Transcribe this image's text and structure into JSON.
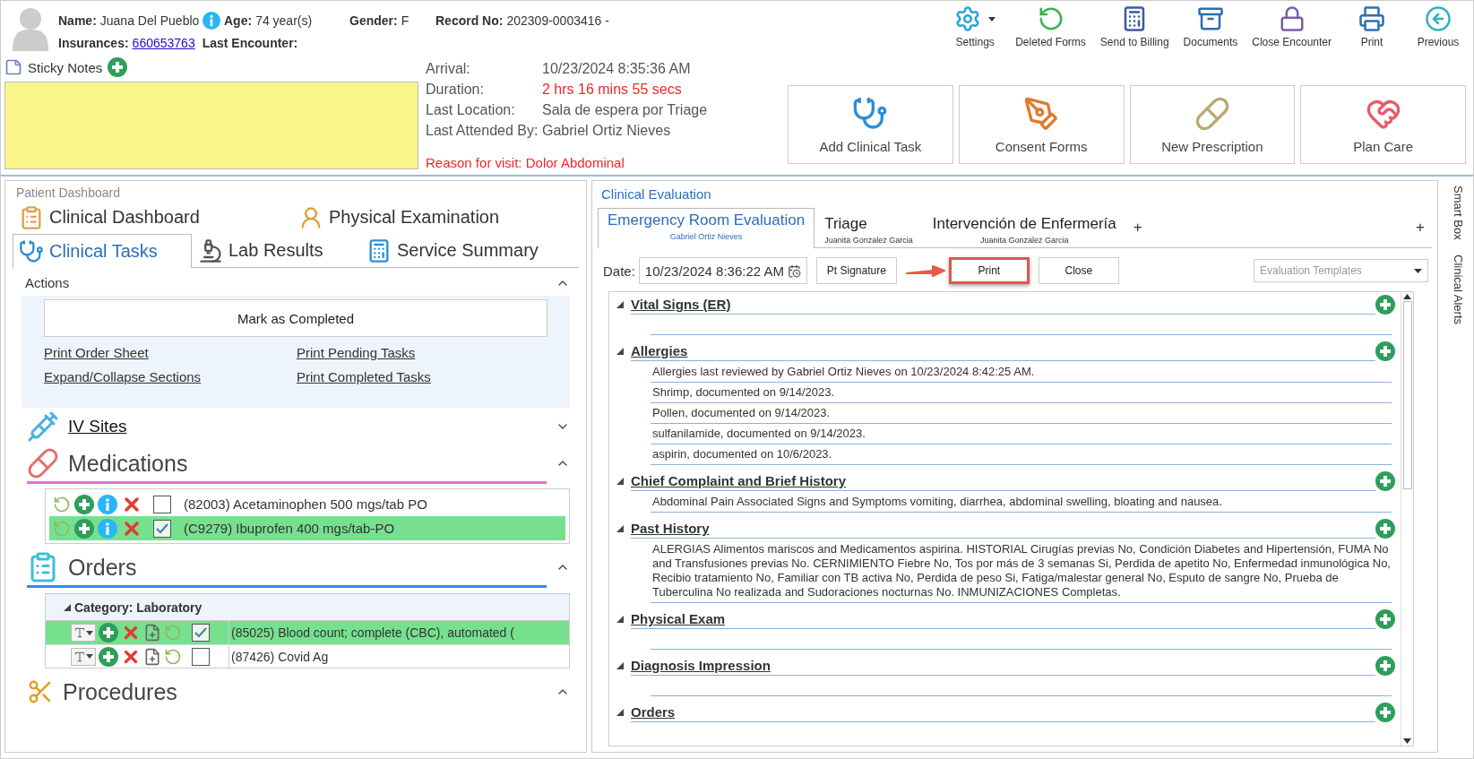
{
  "patient": {
    "name": {
      "label": "Name:",
      "value": "Juana Del Pueblo"
    },
    "age": {
      "label": "Age:",
      "value": "74 year(s)"
    },
    "gender": {
      "label": "Gender:",
      "value": "F"
    },
    "record": {
      "label": "Record No:",
      "value": "202309-0003416 -"
    },
    "insurance": {
      "label": "Insurances:",
      "value": "660653763"
    },
    "last_encounter": {
      "label": "Last Encounter:"
    }
  },
  "toolbar": [
    {
      "label": "Settings",
      "kind": "settings",
      "has_menu": true
    },
    {
      "label": "Deleted Forms",
      "kind": "deleted",
      "has_menu": false
    },
    {
      "label": "Send to Billing",
      "kind": "billing",
      "has_menu": false
    },
    {
      "label": "Documents",
      "kind": "documents",
      "has_menu": false
    },
    {
      "label": "Close Encounter",
      "kind": "lock",
      "has_menu": false
    },
    {
      "label": "Print",
      "kind": "print",
      "has_menu": false
    },
    {
      "label": "Previous",
      "kind": "previous",
      "has_menu": false
    }
  ],
  "sticky_notes": {
    "title": "Sticky Notes"
  },
  "visit": {
    "rows": [
      {
        "label": "Arrival:",
        "value": "10/23/2024 8:35:36 AM",
        "alert": false
      },
      {
        "label": "Duration:",
        "value": "2 hrs 16 mins 55 secs",
        "alert": true
      },
      {
        "label": "Last Location:",
        "value": "Sala de espera por Triage",
        "alert": false
      },
      {
        "label": "Last Attended By:",
        "value": "Gabriel Ortiz Nieves",
        "alert": false
      }
    ],
    "reason": "Reason for visit: Dolor Abdominal"
  },
  "quick_actions": [
    {
      "label": "Add Clinical Task",
      "kind": "task"
    },
    {
      "label": "Consent Forms",
      "kind": "consent"
    },
    {
      "label": "New Prescription",
      "kind": "prescription"
    },
    {
      "label": "Plan Care",
      "kind": "plan"
    }
  ],
  "dashboard": {
    "title": "Patient Dashboard",
    "tab_rows": [
      [
        {
          "label": "Clinical Dashboard",
          "kind": "dashboard",
          "selected": false
        },
        {
          "label": "Physical Examination",
          "kind": "exam",
          "selected": false
        }
      ],
      [
        {
          "label": "Clinical Tasks",
          "kind": "tasks",
          "selected": true
        },
        {
          "label": "Lab Results",
          "kind": "lab",
          "selected": false
        },
        {
          "label": "Service Summary",
          "kind": "summary",
          "selected": false
        }
      ]
    ],
    "actions": {
      "title": "Actions",
      "expanded": true,
      "button": "Mark as Completed",
      "links": [
        "Print Order Sheet",
        "Print Pending Tasks",
        "Expand/Collapse Sections",
        "Print Completed Tasks"
      ]
    },
    "sections": [
      {
        "title": "IV Sites",
        "kind": "iv",
        "expanded": false
      },
      {
        "title": "Medications",
        "kind": "meds",
        "expanded": true,
        "color": "#e070dc",
        "items": [
          {
            "text": "(82003) Acetaminophen 500 mgs/tab PO",
            "checked": false
          },
          {
            "text": "(C9279) Ibuprofen 400 mgs/tab-PO",
            "checked": true
          }
        ]
      },
      {
        "title": "Orders",
        "kind": "orders",
        "expanded": true,
        "color": "#2f8cf0",
        "category": {
          "label": "Category: Laboratory",
          "expanded": true
        },
        "items": [
          {
            "text": "(85025) Blood count; complete (CBC), automated (",
            "checked": true
          },
          {
            "text": "(87426) Covid Ag",
            "checked": false
          }
        ]
      },
      {
        "title": "Procedures",
        "kind": "procedures",
        "expanded": true
      }
    ]
  },
  "evaluation": {
    "title": "Clinical Evaluation",
    "tabs": [
      {
        "title": "Emergency Room Evaluation",
        "subtitle": "Gabriel Ortiz Nieves",
        "selected": true
      },
      {
        "title": "Triage",
        "subtitle": "Juanita Gonzalez Garcia",
        "selected": false
      },
      {
        "title": "Intervención de Enfermería",
        "subtitle": "Juanita Gonzalez Garcia",
        "selected": false
      }
    ],
    "tab_add": "+",
    "pane_add": "+",
    "date": {
      "label": "Date:",
      "value": "10/23/2024 8:36:22 AM"
    },
    "buttons": [
      {
        "label": "Pt Signature",
        "annotated": false
      },
      {
        "label": "Print",
        "annotated": true
      },
      {
        "label": "Close",
        "annotated": false
      }
    ],
    "templates": {
      "placeholder": "Evaluation Templates"
    },
    "sections": [
      {
        "title": "Vital Signs (ER)",
        "expanded": true
      },
      {
        "title": "Allergies",
        "expanded": true,
        "items": [
          "Allergies last reviewed by Gabriel Ortiz Nieves on 10/23/2024 8:42:25 AM.",
          "Shrimp, documented on 9/14/2023.",
          "Pollen, documented on 9/14/2023.",
          "sulfanilamide, documented on 9/14/2023.",
          "aspirin, documented on 10/6/2023."
        ]
      },
      {
        "title": "Chief Complaint and Brief History",
        "expanded": true,
        "items": [
          "Abdominal Pain Associated Signs and Symptoms vomiting, diarrhea, abdominal swelling, bloating and nausea."
        ]
      },
      {
        "title": "Past History",
        "expanded": true,
        "items": [
          "ALERGIAS Alimentos mariscos and Medicamentos aspirina. HISTORIAL Cirugías previas No, Condición Diabetes and Hipertensión, FUMA No and Transfusiones previas No. CERNIMIENTO Fiebre No, Tos por más de 3 semanas Si, Perdida de apetito No, Enfermedad inmunológica No, Recibio tratamiento No, Familiar con TB activa No, Perdida de peso Si, Fatiga/malestar general No, Esputo de sangre No, Prueba de Tuberculina No realizada and Sudoraciones nocturnas No. INMUNIZACIONES Completas."
        ]
      },
      {
        "title": "Physical Exam",
        "expanded": true
      },
      {
        "title": "Diagnosis Impression",
        "expanded": true
      },
      {
        "title": "Orders",
        "expanded": true
      }
    ]
  },
  "side_tabs": [
    "Smart Box",
    "Clinical Alerts"
  ]
}
